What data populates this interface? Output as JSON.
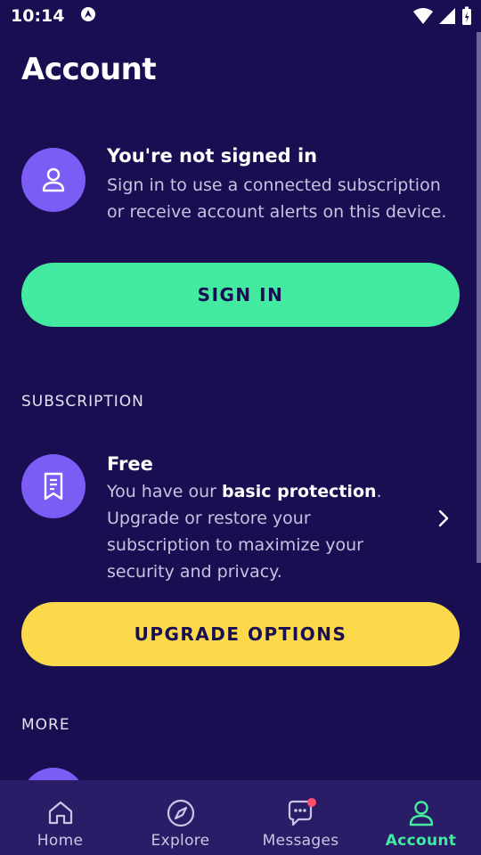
{
  "status": {
    "time": "10:14"
  },
  "page": {
    "title": "Account"
  },
  "signin": {
    "title": "You're not signed in",
    "description": "Sign in to use a connected subscription or receive account alerts on this device.",
    "button": "SIGN IN"
  },
  "subscription": {
    "section_label": "SUBSCRIPTION",
    "plan": "Free",
    "desc_prefix": "You have our ",
    "desc_bold": "basic protection",
    "desc_suffix": ". Upgrade or restore your subscription to maximize your security and privacy.",
    "button": "UPGRADE OPTIONS"
  },
  "more": {
    "section_label": "MORE"
  },
  "nav": {
    "items": [
      {
        "label": "Home",
        "icon": "home-icon"
      },
      {
        "label": "Explore",
        "icon": "compass-icon"
      },
      {
        "label": "Messages",
        "icon": "chat-icon",
        "badge": true
      },
      {
        "label": "Account",
        "icon": "person-icon",
        "active": true
      }
    ]
  },
  "colors": {
    "background": "#190e52",
    "accent_green": "#42eba0",
    "accent_yellow": "#fbd94b",
    "avatar_purple": "#7b5cf5",
    "nav_background": "#2a1c66",
    "badge_red": "#ff4d6d"
  }
}
